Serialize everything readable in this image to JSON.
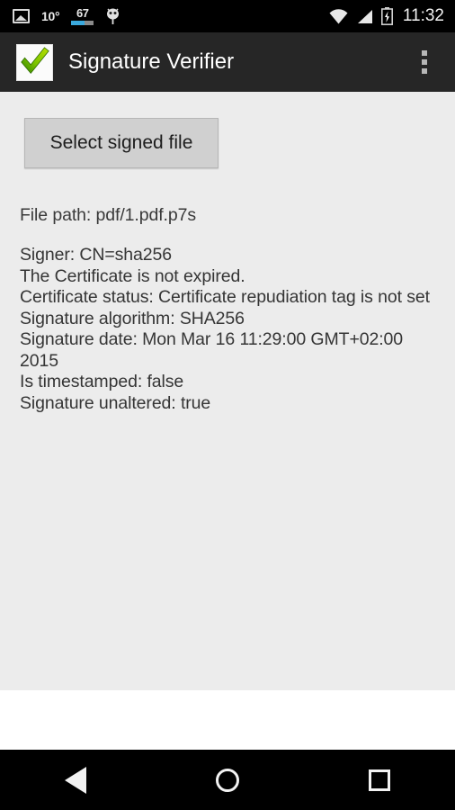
{
  "status_bar": {
    "photo_icon": "photo-icon",
    "temperature": "10°",
    "battery_percent": "67",
    "bug_icon": "bug-icon",
    "wifi_icon": "wifi-icon",
    "signal_icon": "signal-icon",
    "battery_icon": "battery-charging-icon",
    "time": "11:32"
  },
  "action_bar": {
    "app_icon": "green-checkmark-icon",
    "title": "Signature Verifier",
    "overflow_icon": "overflow-menu-icon"
  },
  "main": {
    "select_button_label": "Select signed file",
    "file_path": "File path: pdf/1.pdf.p7s",
    "info_lines": [
      "Signer: CN=sha256",
      "The Certificate is not expired.",
      "Certificate status: Certificate repudiation tag is not set",
      "Signature algorithm: SHA256",
      "Signature date: Mon Mar 16 11:29:00 GMT+02:00 2015",
      "Is timestamped: false",
      "Signature unaltered: true"
    ]
  },
  "nav_bar": {
    "back": "back-button",
    "home": "home-button",
    "recents": "recents-button"
  },
  "colors": {
    "status_bar_bg": "#000000",
    "action_bar_bg": "#262626",
    "content_bg": "#ececec",
    "button_bg": "#d0d0d0",
    "accent_blue": "#3aa9dd",
    "check_green": "#78c000"
  }
}
